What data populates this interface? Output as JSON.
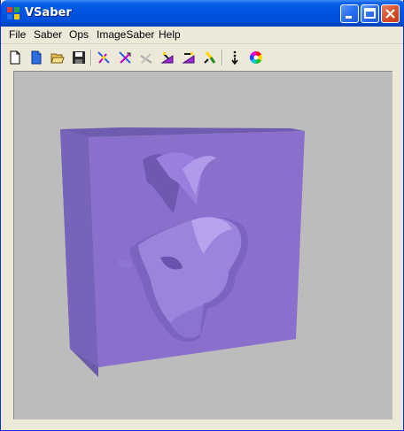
{
  "window": {
    "title": "VSaber"
  },
  "menu": {
    "items": [
      "File",
      "Saber",
      "Ops",
      "ImageSaber",
      "Help"
    ]
  },
  "toolbar": {
    "buttons": [
      {
        "name": "new-document-icon"
      },
      {
        "name": "new-blue-document-icon"
      },
      {
        "name": "open-folder-icon"
      },
      {
        "name": "save-disk-icon"
      },
      {
        "name": "saber-tool-1-icon"
      },
      {
        "name": "saber-tool-2-icon"
      },
      {
        "name": "saber-tool-disabled-icon"
      },
      {
        "name": "saber-tool-3-icon"
      },
      {
        "name": "saber-tool-4-icon"
      },
      {
        "name": "paint-brush-icon"
      },
      {
        "name": "dots-arrow-icon"
      },
      {
        "name": "color-wheel-icon"
      }
    ]
  },
  "viewport": {
    "content": "3d-relief-rendering",
    "color": "#8a70cc"
  }
}
